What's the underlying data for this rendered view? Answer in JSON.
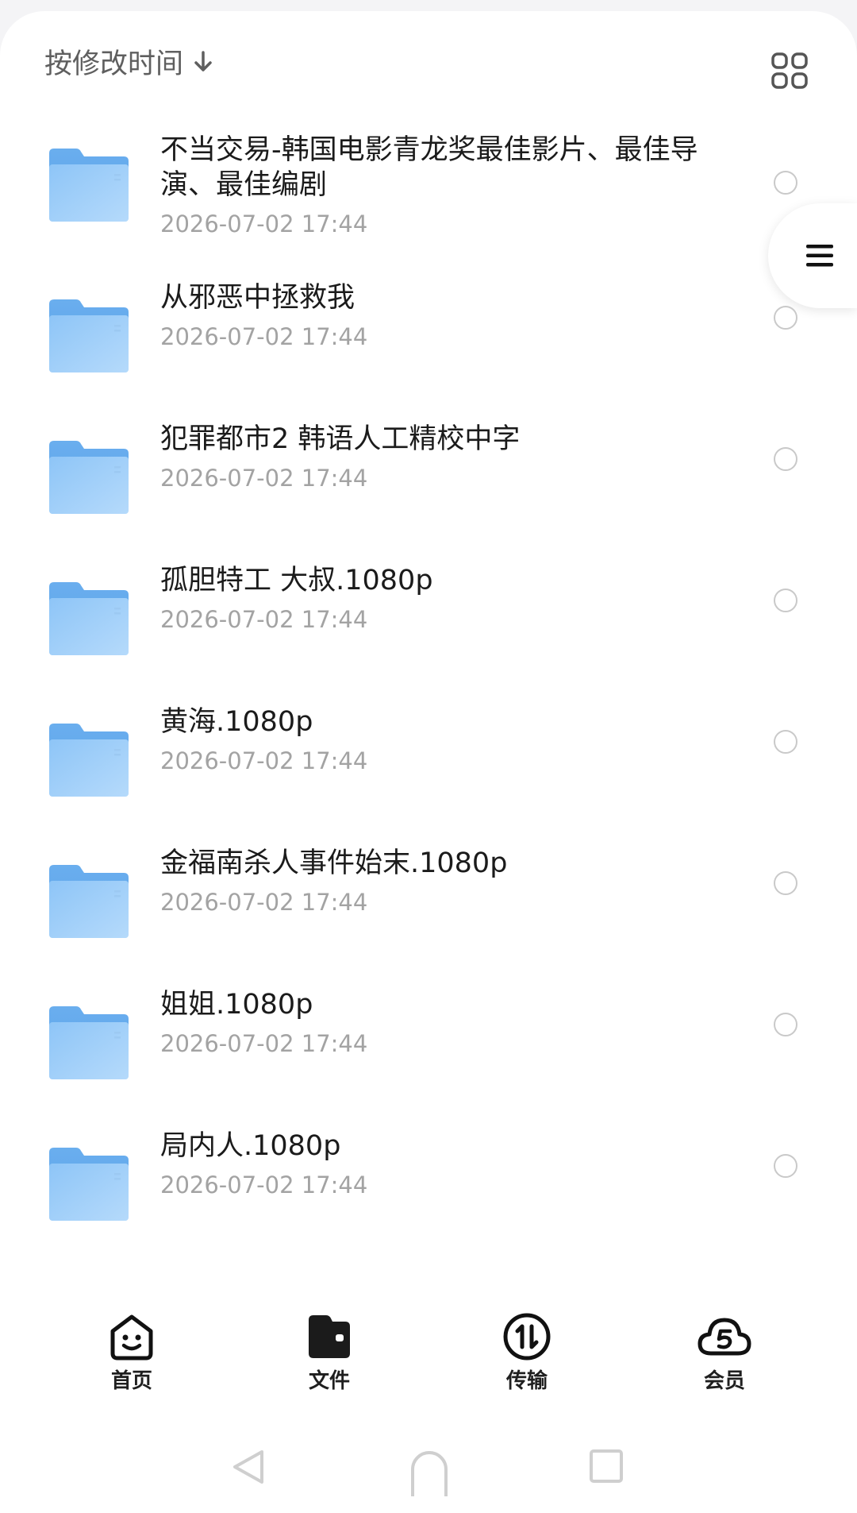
{
  "sort": {
    "label": "按修改时间"
  },
  "files": [
    {
      "name": "不当交易-韩国电影青龙奖最佳影片、最佳导演、最佳编剧",
      "date": "2026-07-02 17:44"
    },
    {
      "name": "从邪恶中拯救我",
      "date": "2026-07-02 17:44"
    },
    {
      "name": "犯罪都市2 韩语人工精校中字",
      "date": "2026-07-02 17:44"
    },
    {
      "name": "孤胆特工 大叔.1080p",
      "date": "2026-07-02 17:44"
    },
    {
      "name": "黄海.1080p",
      "date": "2026-07-02 17:44"
    },
    {
      "name": "金福南杀人事件始末.1080p",
      "date": "2026-07-02 17:44"
    },
    {
      "name": "姐姐.1080p",
      "date": "2026-07-02 17:44"
    },
    {
      "name": "局内人.1080p",
      "date": "2026-07-02 17:44"
    }
  ],
  "tabs": [
    {
      "label": "首页",
      "icon": "home-face-icon"
    },
    {
      "label": "文件",
      "icon": "folder-wallet-icon",
      "active": true
    },
    {
      "label": "传输",
      "icon": "transfer-icon"
    },
    {
      "label": "会员",
      "icon": "cloud-vip-icon"
    }
  ],
  "colors": {
    "folder": "#7ab8f5",
    "text": "#1b1b1b",
    "date": "#a3a3a3"
  }
}
